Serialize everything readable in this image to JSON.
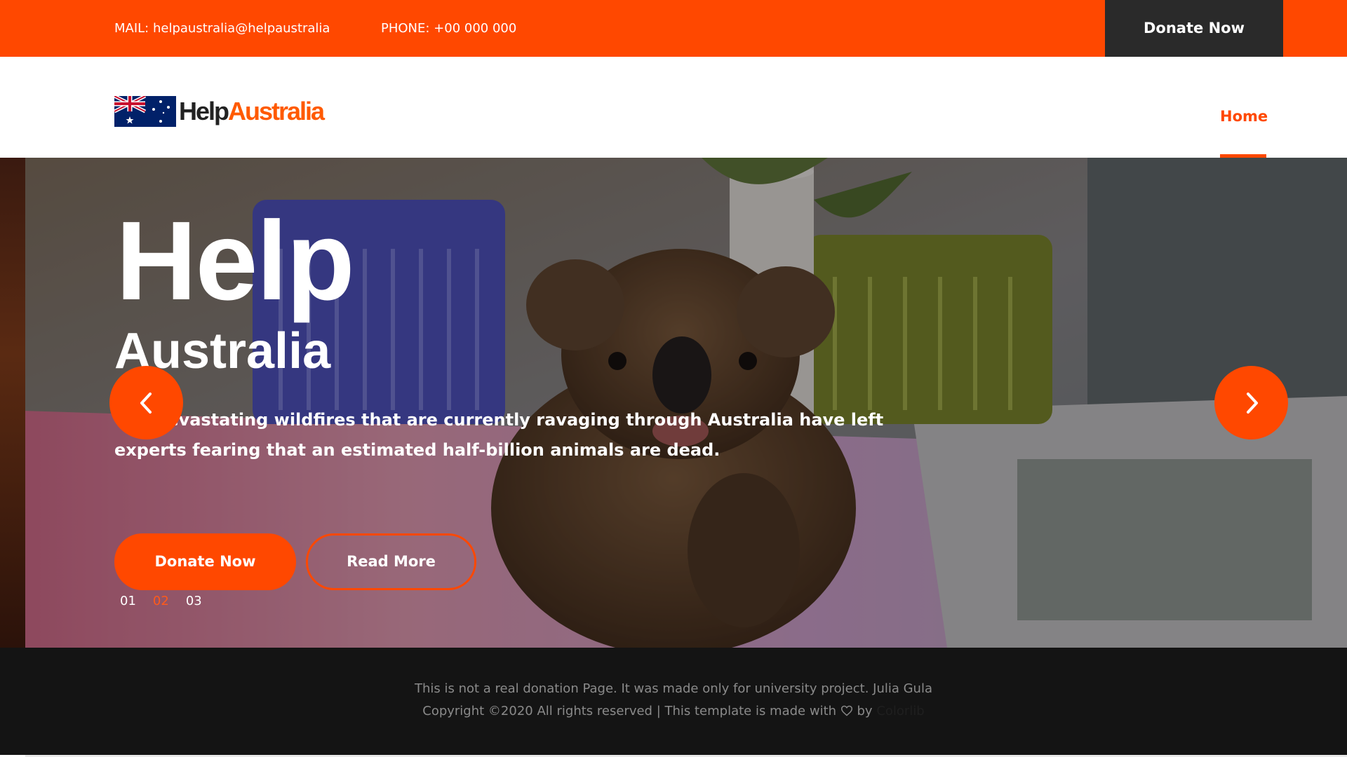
{
  "topbar": {
    "mail": "MAIL: helpaustralia@helpaustralia",
    "phone": "PHONE: +00 000 000",
    "donate_label": "Donate Now"
  },
  "header": {
    "logo_part1": "Help",
    "logo_part2": "Australia",
    "nav": {
      "home_label": "Home"
    }
  },
  "hero": {
    "title": "Help",
    "subtitle": "Australia",
    "description": "The devastating wildfires that are currently ravaging through Australia have left experts fearing that an estimated half-billion animals are dead.",
    "donate_label": "Donate Now",
    "read_more_label": "Read More",
    "slides": [
      "01",
      "02",
      "03"
    ],
    "active_slide": "02",
    "prev_icon": "chevron-left-icon",
    "next_icon": "chevron-right-icon"
  },
  "footer": {
    "line1": "This is not a real donation Page. It was made only for university project. Julia Gula",
    "line2_prefix": "Copyright ©2020 All rights reserved | This template is made with",
    "line2_by": "by",
    "credit_link": "Colorlib",
    "heart_icon": "heart-icon"
  },
  "colors": {
    "accent": "#ff4800",
    "dark": "#2a2a2a",
    "footer_bg": "#141414"
  }
}
